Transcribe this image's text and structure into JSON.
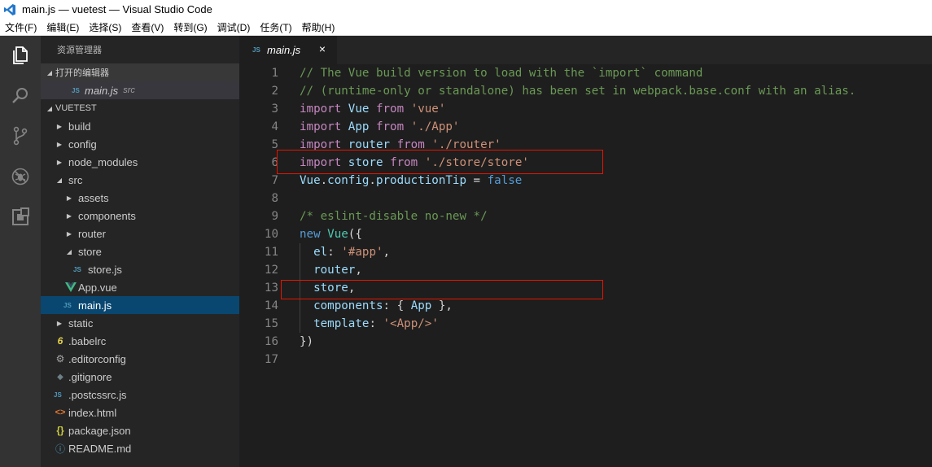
{
  "window": {
    "title": "main.js — vuetest — Visual Studio Code"
  },
  "menu": [
    "文件(F)",
    "编辑(E)",
    "选择(S)",
    "查看(V)",
    "转到(G)",
    "调试(D)",
    "任务(T)",
    "帮助(H)"
  ],
  "activity_bar": [
    {
      "name": "explorer-icon",
      "active": true
    },
    {
      "name": "search-icon",
      "active": false
    },
    {
      "name": "source-control-icon",
      "active": false
    },
    {
      "name": "debug-icon",
      "active": false
    },
    {
      "name": "extensions-icon",
      "active": false
    }
  ],
  "sidebar": {
    "title": "资源管理器",
    "open_editors": {
      "label": "打开的编辑器",
      "items": [
        {
          "icon": "JS",
          "name": "main.js",
          "desc": "src"
        }
      ]
    },
    "project": {
      "label": "VUETEST",
      "tree": [
        {
          "depth": 1,
          "type": "folder",
          "open": false,
          "name": "build"
        },
        {
          "depth": 1,
          "type": "folder",
          "open": false,
          "name": "config"
        },
        {
          "depth": 1,
          "type": "folder",
          "open": false,
          "name": "node_modules"
        },
        {
          "depth": 1,
          "type": "folder",
          "open": true,
          "name": "src"
        },
        {
          "depth": 2,
          "type": "folder",
          "open": false,
          "name": "assets"
        },
        {
          "depth": 2,
          "type": "folder",
          "open": false,
          "name": "components"
        },
        {
          "depth": 2,
          "type": "folder",
          "open": false,
          "name": "router"
        },
        {
          "depth": 2,
          "type": "folder",
          "open": true,
          "name": "store"
        },
        {
          "depth": 3,
          "type": "js",
          "name": "store.js"
        },
        {
          "depth": 2,
          "type": "vue",
          "name": "App.vue"
        },
        {
          "depth": 2,
          "type": "js",
          "name": "main.js",
          "selected": true
        },
        {
          "depth": 1,
          "type": "folder",
          "open": false,
          "name": "static"
        },
        {
          "depth": 1,
          "type": "babel",
          "name": ".babelrc"
        },
        {
          "depth": 1,
          "type": "gear",
          "name": ".editorconfig"
        },
        {
          "depth": 1,
          "type": "git",
          "name": ".gitignore"
        },
        {
          "depth": 1,
          "type": "js",
          "name": ".postcssrc.js"
        },
        {
          "depth": 1,
          "type": "html",
          "name": "index.html"
        },
        {
          "depth": 1,
          "type": "json",
          "name": "package.json"
        },
        {
          "depth": 1,
          "type": "info",
          "name": "README.md"
        }
      ]
    }
  },
  "tabs": [
    {
      "icon": "JS",
      "label": "main.js",
      "close": "×"
    }
  ],
  "editor": {
    "lines": [
      {
        "n": "1",
        "tokens": [
          {
            "t": "// The Vue build version to load with the `import` command",
            "c": "c"
          }
        ]
      },
      {
        "n": "2",
        "tokens": [
          {
            "t": "// (runtime-only or standalone) has been set in webpack.base.conf with an alias.",
            "c": "c"
          }
        ]
      },
      {
        "n": "3",
        "tokens": [
          {
            "t": "import",
            "c": "k"
          },
          {
            "t": " "
          },
          {
            "t": "Vue",
            "c": "v"
          },
          {
            "t": " "
          },
          {
            "t": "from",
            "c": "k"
          },
          {
            "t": " "
          },
          {
            "t": "'vue'",
            "c": "s"
          }
        ]
      },
      {
        "n": "4",
        "tokens": [
          {
            "t": "import",
            "c": "k"
          },
          {
            "t": " "
          },
          {
            "t": "App",
            "c": "v"
          },
          {
            "t": " "
          },
          {
            "t": "from",
            "c": "k"
          },
          {
            "t": " "
          },
          {
            "t": "'./App'",
            "c": "s"
          }
        ]
      },
      {
        "n": "5",
        "tokens": [
          {
            "t": "import",
            "c": "k"
          },
          {
            "t": " "
          },
          {
            "t": "router",
            "c": "v"
          },
          {
            "t": " "
          },
          {
            "t": "from",
            "c": "k"
          },
          {
            "t": " "
          },
          {
            "t": "'./router'",
            "c": "s"
          }
        ]
      },
      {
        "n": "6",
        "tokens": [
          {
            "t": "import",
            "c": "k"
          },
          {
            "t": " "
          },
          {
            "t": "store",
            "c": "v"
          },
          {
            "t": " "
          },
          {
            "t": "from",
            "c": "k"
          },
          {
            "t": " "
          },
          {
            "t": "'./store/store'",
            "c": "s"
          }
        ]
      },
      {
        "n": "7",
        "tokens": [
          {
            "t": "Vue",
            "c": "v"
          },
          {
            "t": "."
          },
          {
            "t": "config",
            "c": "v"
          },
          {
            "t": "."
          },
          {
            "t": "productionTip",
            "c": "v"
          },
          {
            "t": " = "
          },
          {
            "t": "false",
            "c": "b"
          }
        ]
      },
      {
        "n": "8",
        "tokens": []
      },
      {
        "n": "9",
        "tokens": [
          {
            "t": "/* eslint-disable no-new */",
            "c": "c"
          }
        ]
      },
      {
        "n": "10",
        "tokens": [
          {
            "t": "new",
            "c": "b"
          },
          {
            "t": " "
          },
          {
            "t": "Vue",
            "c": "tyc"
          },
          {
            "t": "({"
          }
        ]
      },
      {
        "n": "11",
        "guide": true,
        "tokens": [
          {
            "t": "  "
          },
          {
            "t": "el",
            "c": "v"
          },
          {
            "t": ": "
          },
          {
            "t": "'#app'",
            "c": "s"
          },
          {
            "t": ","
          }
        ]
      },
      {
        "n": "12",
        "guide": true,
        "tokens": [
          {
            "t": "  "
          },
          {
            "t": "router",
            "c": "v"
          },
          {
            "t": ","
          }
        ]
      },
      {
        "n": "13",
        "guide": true,
        "tokens": [
          {
            "t": "  "
          },
          {
            "t": "store",
            "c": "v"
          },
          {
            "t": ","
          }
        ]
      },
      {
        "n": "14",
        "guide": true,
        "tokens": [
          {
            "t": "  "
          },
          {
            "t": "components",
            "c": "v"
          },
          {
            "t": ": { "
          },
          {
            "t": "App",
            "c": "v"
          },
          {
            "t": " },"
          }
        ]
      },
      {
        "n": "15",
        "guide": true,
        "tokens": [
          {
            "t": "  "
          },
          {
            "t": "template",
            "c": "v"
          },
          {
            "t": ": "
          },
          {
            "t": "'<App/>'",
            "c": "s"
          }
        ]
      },
      {
        "n": "16",
        "tokens": [
          {
            "t": "})"
          }
        ]
      },
      {
        "n": "17",
        "tokens": []
      }
    ],
    "highlighted_lines": [
      "6",
      "13"
    ]
  },
  "colors": {
    "highlight_box": "#e51400",
    "selection": "#094771",
    "js_icon": "#519aba"
  }
}
